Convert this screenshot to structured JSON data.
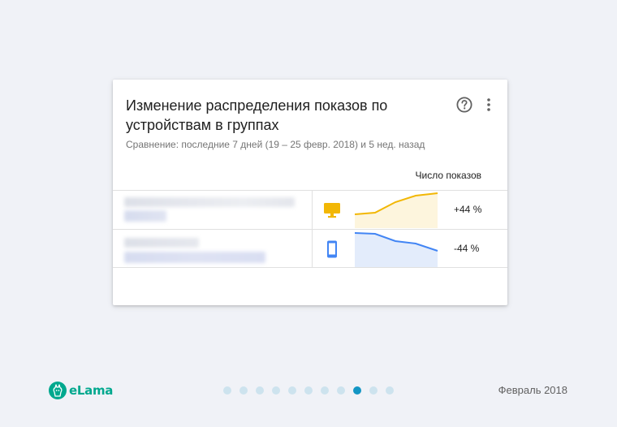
{
  "card": {
    "title": "Изменение распределения показов по устройствам в группах",
    "subtitle": "Сравнение: последние 7 дней (19 – 25 февр. 2018) и 5 нед. назад",
    "column_header": "Число показов",
    "rows": [
      {
        "device_icon": "desktop-icon",
        "device_color": "#f2b705",
        "change": "+44 %",
        "trend": "up",
        "spark_fill": "#fdf5dd"
      },
      {
        "device_icon": "mobile-icon",
        "device_color": "#4285f4",
        "change": "-44 %",
        "trend": "down",
        "spark_fill": "#e3ecfb"
      }
    ]
  },
  "footer": {
    "brand": "eLama",
    "brand_color": "#00a88e",
    "date": "Февраль 2018",
    "pagination": {
      "total": 11,
      "active_index": 8
    }
  }
}
